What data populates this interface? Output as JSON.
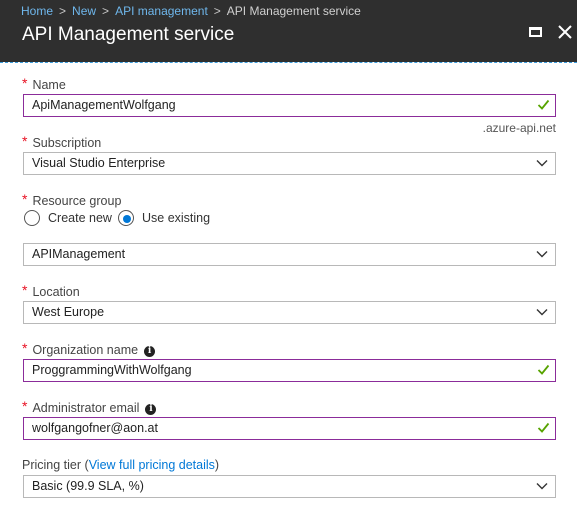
{
  "breadcrumb": {
    "items": [
      "Home",
      "New",
      "API management"
    ],
    "current": "API Management service"
  },
  "header": {
    "title": "API Management service"
  },
  "form": {
    "name": {
      "label": "Name",
      "value": "ApiManagementWolfgang",
      "suffix": ".azure-api.net"
    },
    "subscription": {
      "label": "Subscription",
      "value": "Visual Studio Enterprise"
    },
    "resource_group": {
      "label": "Resource group",
      "options": [
        "Create new",
        "Use existing"
      ],
      "selected": "Use existing",
      "value": "APIManagement"
    },
    "location": {
      "label": "Location",
      "value": "West Europe"
    },
    "organization_name": {
      "label": "Organization name",
      "value": "ProggrammingWithWolfgang"
    },
    "administrator_email": {
      "label": "Administrator email",
      "value": "wolfgangofner@aon.at"
    },
    "pricing_tier": {
      "label_prefix": "Pricing tier (",
      "link_text": "View full pricing details",
      "label_suffix": ")",
      "value": "Basic (99.9 SLA, %)"
    }
  },
  "colors": {
    "header_bg": "#2f2f2f",
    "link": "#6fb7ec",
    "required": "#e81123",
    "valid_border": "#8b2c9a",
    "check": "#57a300",
    "radio": "#0078d7"
  },
  "icons": [
    "close-icon",
    "maximize-icon",
    "checkmark-icon",
    "chevron-down-icon",
    "info-icon"
  ]
}
